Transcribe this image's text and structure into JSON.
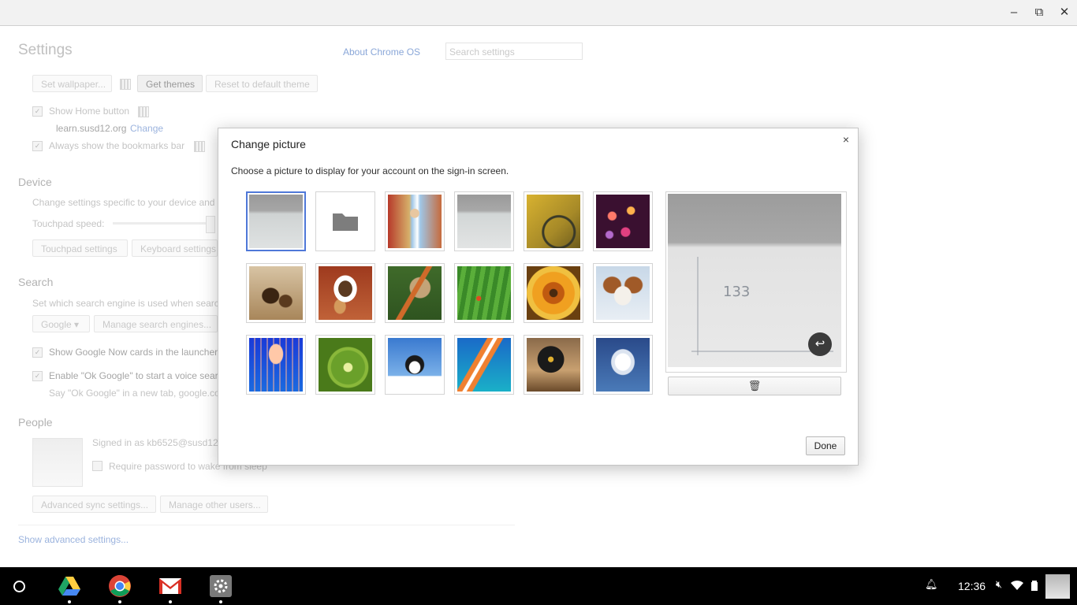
{
  "window": {
    "minimize_icon": "minimize-icon",
    "maximize_icon": "restore-icon",
    "close_icon": "close-icon",
    "minimize_glyph": "–",
    "maximize_glyph": "⧉",
    "close_glyph": "✕"
  },
  "settings": {
    "title": "Settings",
    "about_link": "About Chrome OS",
    "search_placeholder": "Search settings",
    "appearance": {
      "set_wallpaper": "Set wallpaper...",
      "get_themes": "Get themes",
      "reset_theme": "Reset to default theme",
      "show_home_button": "Show Home button",
      "home_url": "learn.susd12.org",
      "home_change": "Change",
      "always_show_bookmarks": "Always show the bookmarks bar"
    },
    "device": {
      "heading": "Device",
      "description": "Change settings specific to your device and",
      "touchpad_speed": "Touchpad speed:",
      "touchpad_settings": "Touchpad settings",
      "keyboard_settings": "Keyboard settings"
    },
    "search": {
      "heading": "Search",
      "description": "Set which search engine is used when searc",
      "engine": "Google",
      "manage_engines": "Manage search engines...",
      "google_now": "Show Google Now cards in the launcher",
      "ok_google": "Enable \"Ok Google\" to start a voice searc",
      "ok_google_hint": "Say \"Ok Google\" in a new tab, google.co"
    },
    "people": {
      "heading": "People",
      "signed_in": "Signed in as kb6525@susd12",
      "require_password": "Require password to wake from sleep",
      "advanced_sync": "Advanced sync settings...",
      "manage_users": "Manage other users..."
    },
    "show_advanced": "Show advanced settings..."
  },
  "dialog": {
    "title": "Change picture",
    "close_glyph": "×",
    "description": "Choose a picture to display for your account on the sign-in screen.",
    "pictures": [
      {
        "name": "current-photo",
        "selected": true
      },
      {
        "name": "choose-file",
        "selected": false
      },
      {
        "name": "soccer-player",
        "selected": false
      },
      {
        "name": "old-photo",
        "selected": false
      },
      {
        "name": "bicycle",
        "selected": false
      },
      {
        "name": "bokeh-lights",
        "selected": false
      },
      {
        "name": "chess-pieces",
        "selected": false
      },
      {
        "name": "coffee-cup",
        "selected": false
      },
      {
        "name": "dragonfly",
        "selected": false
      },
      {
        "name": "tree-frog",
        "selected": false
      },
      {
        "name": "orange-flower",
        "selected": false
      },
      {
        "name": "puppy",
        "selected": false
      },
      {
        "name": "jellyfish",
        "selected": false
      },
      {
        "name": "kiwi-slice",
        "selected": false
      },
      {
        "name": "penguin",
        "selected": false
      },
      {
        "name": "tropical-fish",
        "selected": false
      },
      {
        "name": "turntable",
        "selected": false
      },
      {
        "name": "white-flower",
        "selected": false
      }
    ],
    "preview_handwriting": "133",
    "flip_glyph": "↩",
    "trash_glyph": "🗑",
    "done_label": "Done"
  },
  "shelf": {
    "apps": [
      "Google Drive",
      "Google Chrome",
      "Gmail",
      "Settings"
    ],
    "time": "12:36",
    "tray_icons": [
      "notification-bell-icon",
      "volume-muted-icon",
      "wifi-icon",
      "battery-icon"
    ]
  }
}
